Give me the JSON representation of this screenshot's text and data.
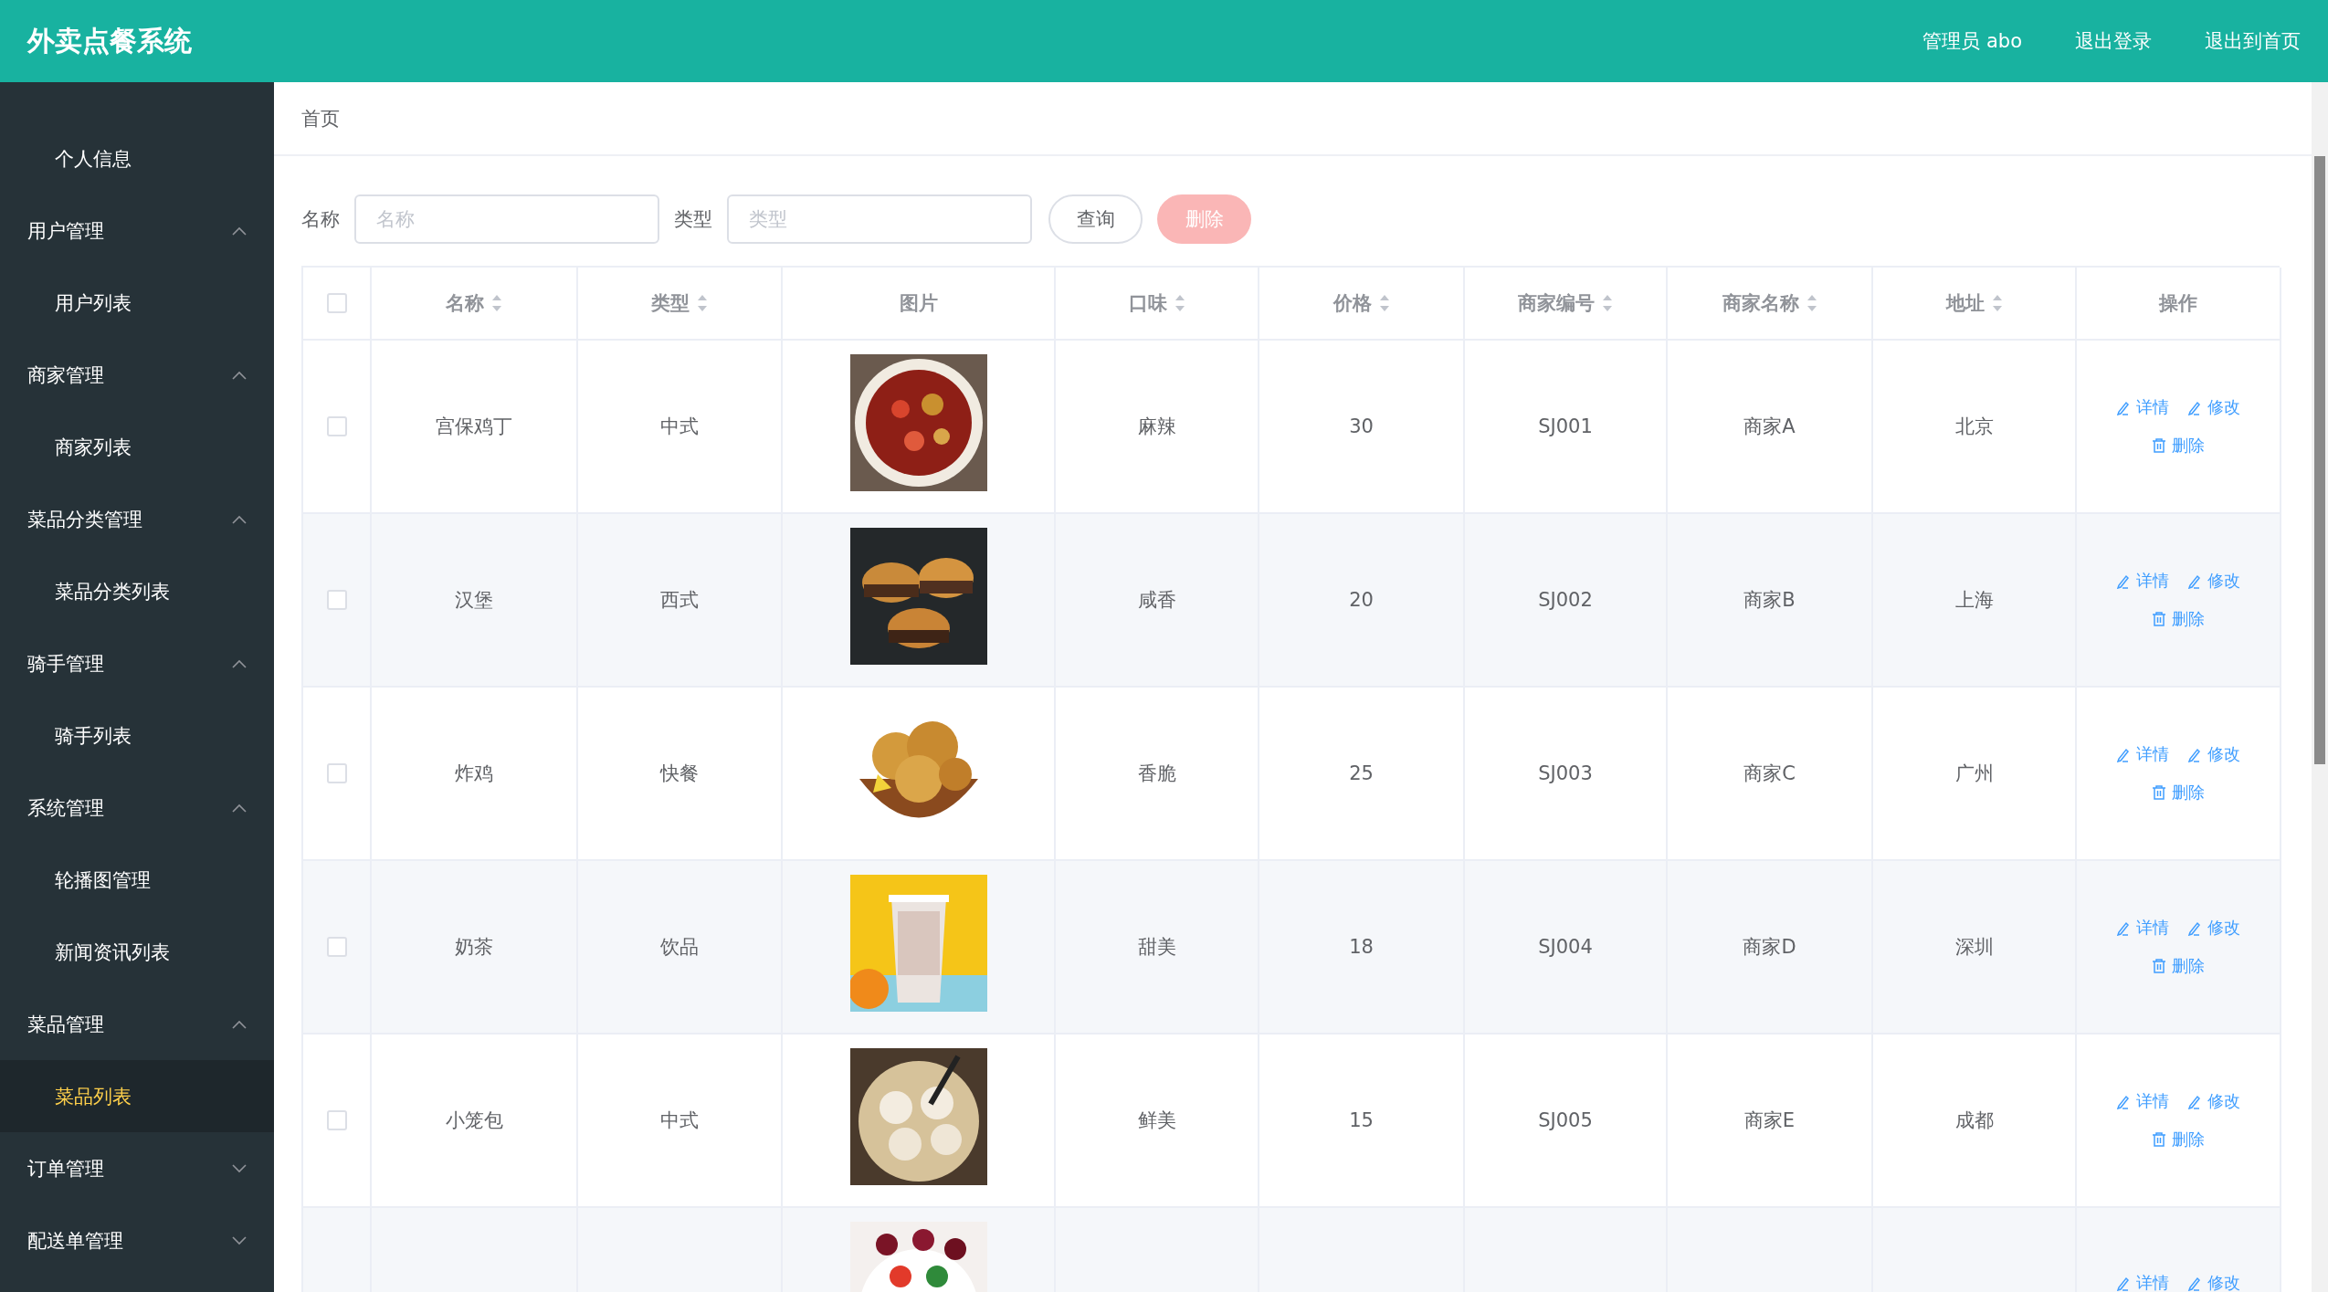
{
  "header": {
    "title": "外卖点餐系统",
    "links": [
      "管理员 abo",
      "退出登录",
      "退出到首页"
    ]
  },
  "sidebar": {
    "items": [
      {
        "kind": "sub",
        "label": "个人信息",
        "selected": false
      },
      {
        "kind": "group",
        "label": "用户管理",
        "expanded": true
      },
      {
        "kind": "sub",
        "label": "用户列表",
        "selected": false
      },
      {
        "kind": "group",
        "label": "商家管理",
        "expanded": true
      },
      {
        "kind": "sub",
        "label": "商家列表",
        "selected": false
      },
      {
        "kind": "group",
        "label": "菜品分类管理",
        "expanded": true
      },
      {
        "kind": "sub",
        "label": "菜品分类列表",
        "selected": false
      },
      {
        "kind": "group",
        "label": "骑手管理",
        "expanded": true
      },
      {
        "kind": "sub",
        "label": "骑手列表",
        "selected": false
      },
      {
        "kind": "group",
        "label": "系统管理",
        "expanded": true
      },
      {
        "kind": "sub",
        "label": "轮播图管理",
        "selected": false
      },
      {
        "kind": "sub",
        "label": "新闻资讯列表",
        "selected": false
      },
      {
        "kind": "group",
        "label": "菜品管理",
        "expanded": true
      },
      {
        "kind": "sub",
        "label": "菜品列表",
        "selected": true
      },
      {
        "kind": "group",
        "label": "订单管理",
        "expanded": false
      },
      {
        "kind": "group",
        "label": "配送单管理",
        "expanded": false
      }
    ]
  },
  "breadcrumb": "首页",
  "filters": [
    {
      "label": "名称",
      "placeholder": "名称"
    },
    {
      "label": "类型",
      "placeholder": "类型"
    }
  ],
  "buttons": [
    {
      "kind": "plain",
      "label": "查询",
      "disabled": false
    },
    {
      "kind": "danger",
      "label": "删除",
      "disabled": true
    }
  ],
  "table": {
    "select_all": {
      "checked": false
    },
    "columns": [
      {
        "label": "名称",
        "sortable": true
      },
      {
        "label": "类型",
        "sortable": true
      },
      {
        "label": "图片",
        "sortable": false
      },
      {
        "label": "口味",
        "sortable": true
      },
      {
        "label": "价格",
        "sortable": true
      },
      {
        "label": "商家编号",
        "sortable": true
      },
      {
        "label": "商家名称",
        "sortable": true
      },
      {
        "label": "地址",
        "sortable": true
      },
      {
        "label": "操作",
        "sortable": false
      }
    ],
    "rows": [
      {
        "checked": false,
        "name": "宫保鸡丁",
        "type": "中式",
        "image": {
          "kind": "picture"
        },
        "taste": "麻辣",
        "price": "30",
        "merchant_no": "SJ001",
        "merchant": "商家A",
        "address": "北京",
        "actions": [
          {
            "kind": "edit",
            "label": "详情"
          },
          {
            "kind": "edit",
            "label": "修改"
          },
          {
            "kind": "delete",
            "label": "删除"
          }
        ]
      },
      {
        "checked": false,
        "name": "汉堡",
        "type": "西式",
        "image": {
          "kind": "picture"
        },
        "taste": "咸香",
        "price": "20",
        "merchant_no": "SJ002",
        "merchant": "商家B",
        "address": "上海",
        "actions": [
          {
            "kind": "edit",
            "label": "详情"
          },
          {
            "kind": "edit",
            "label": "修改"
          },
          {
            "kind": "delete",
            "label": "删除"
          }
        ]
      },
      {
        "checked": false,
        "name": "炸鸡",
        "type": "快餐",
        "image": {
          "kind": "picture"
        },
        "taste": "香脆",
        "price": "25",
        "merchant_no": "SJ003",
        "merchant": "商家C",
        "address": "广州",
        "actions": [
          {
            "kind": "edit",
            "label": "详情"
          },
          {
            "kind": "edit",
            "label": "修改"
          },
          {
            "kind": "delete",
            "label": "删除"
          }
        ]
      },
      {
        "checked": false,
        "name": "奶茶",
        "type": "饮品",
        "image": {
          "kind": "picture"
        },
        "taste": "甜美",
        "price": "18",
        "merchant_no": "SJ004",
        "merchant": "商家D",
        "address": "深圳",
        "actions": [
          {
            "kind": "edit",
            "label": "详情"
          },
          {
            "kind": "edit",
            "label": "修改"
          },
          {
            "kind": "delete",
            "label": "删除"
          }
        ]
      },
      {
        "checked": false,
        "name": "小笼包",
        "type": "中式",
        "image": {
          "kind": "picture"
        },
        "taste": "鲜美",
        "price": "15",
        "merchant_no": "SJ005",
        "merchant": "商家E",
        "address": "成都",
        "actions": [
          {
            "kind": "edit",
            "label": "详情"
          },
          {
            "kind": "edit",
            "label": "修改"
          },
          {
            "kind": "delete",
            "label": "删除"
          }
        ]
      },
      {
        "image": {
          "kind": "picture"
        },
        "actions": [
          {
            "kind": "edit",
            "label": "详情"
          },
          {
            "kind": "edit",
            "label": "修改"
          }
        ]
      }
    ]
  }
}
